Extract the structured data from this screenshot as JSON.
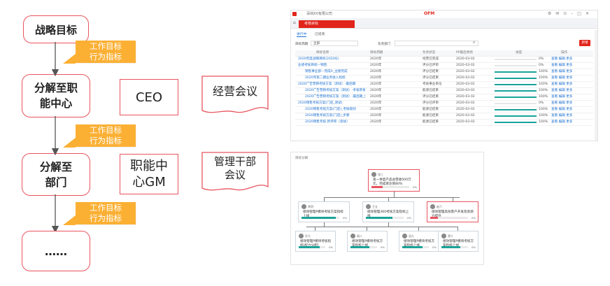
{
  "flow": {
    "step1": "战略目标",
    "step2_line1": "分解至职",
    "step2_line2": "能中心",
    "step3_line1": "分解至",
    "step3_line2": "部门",
    "step4": "……",
    "callout_line1": "工作目标",
    "callout_line2": "行为指标"
  },
  "side": {
    "ceo": "CEO",
    "meeting1": "经营会议",
    "gm_line1": "职能中",
    "gm_line2": "心GM",
    "meeting2_line1": "管理干部",
    "meeting2_line2": "会议"
  },
  "colors": {
    "flow_border": "#e8545e",
    "callout_fill": "#fbb034",
    "accent_red": "#e1251b",
    "progress_teal": "#1aa39a"
  },
  "screenshot1": {
    "company": "深圳XX有限公司",
    "brand": "OFM",
    "tab": "考核目标",
    "subtabs": [
      "进行中",
      "已结束"
    ],
    "filter_labels": [
      "目标周期",
      "全部",
      "负责部门"
    ],
    "new_button": "新增",
    "columns": [
      "目标名称",
      "目标周期",
      "负责状态",
      "PP最后更新",
      "进度",
      "操作"
    ],
    "rows": [
      {
        "name": "2020年度战略目标(2020Q)",
        "period": "2020年",
        "status": "经营已完成",
        "date": "2020-03-02",
        "pct": "0%",
        "p": 0
      },
      {
        "name": "业绩考核目标—销售",
        "period": "2020年",
        "status": "评分已评审",
        "date": "2020-03-02",
        "pct": "0%",
        "p": 0
      },
      {
        "name": "销售事业部—完成A_业绩完成",
        "period": "2020年",
        "status": "评分已结束",
        "date": "2020-03-02",
        "pct": "100%",
        "p": 1
      },
      {
        "name": "2020年第二期业务收入指标",
        "period": "2020年",
        "status": "评分已结束",
        "date": "2020-03-02",
        "pct": "100%",
        "p": 1
      },
      {
        "name": "2020广告营销考核方案（测试）-最后期",
        "period": "2020年",
        "status": "考核事业单位",
        "date": "2020-03-02",
        "pct": "100%",
        "p": 1
      },
      {
        "name": "2020广告营销考核方案（测试）-考核审批",
        "period": "2020年",
        "status": "能源已结束",
        "date": "2020-03-02",
        "pct": "100%",
        "p": 1
      },
      {
        "name": "2020广告营销考核方案（测试）-最后期_步骤",
        "period": "2020年",
        "status": "评分已结束",
        "date": "2020-03-02",
        "pct": "100%",
        "p": 1
      },
      {
        "name": "2020销售考核方案(门店_测试)",
        "period": "2020年",
        "status": "评分已评审",
        "date": "2020-03-02",
        "pct": "0%",
        "p": 0
      },
      {
        "name": "2020销售考核方案(门店)_考核级别",
        "period": "2020年",
        "status": "能源已结束",
        "date": "2020-03-02",
        "pct": "100%",
        "p": 1
      },
      {
        "name": "2020销售考核方案(门店)_步骤",
        "period": "2020年",
        "status": "能源已结束",
        "date": "2020-03-02",
        "pct": "100%",
        "p": 1
      },
      {
        "name": "2020销售考核 新评审（测试）",
        "period": "2020年",
        "status": "能源已结束",
        "date": "2020-03-02",
        "pct": "100%",
        "p": 1
      }
    ],
    "actions": [
      "查看",
      "编辑",
      "更多"
    ]
  },
  "screenshot2": {
    "title": "目标分解",
    "root": {
      "name": "张三",
      "text": "第一季度产品总营收500万元，完成率达到80%",
      "pct": "0%",
      "p": 0.3
    },
    "level2": [
      {
        "name": "李四",
        "text": "绩效管理P模块考核方案指标上线",
        "pct": "0%",
        "p": 0.9
      },
      {
        "name": "王五",
        "text": "绩效管理360考核方案指标上线",
        "pct": "0%",
        "p": 0.7
      },
      {
        "name": "赵六",
        "text": "绩效管理高效客户开发及资源力提升",
        "pct": "0%",
        "p": 0.2
      }
    ],
    "level3": [
      {
        "name": "孙七",
        "text": "绩效管理P模块考核指标(权力分配)",
        "pct": "0%",
        "p": 0.8
      },
      {
        "name": "周八",
        "text": "绩效管理P模块考核方案指标上线",
        "pct": "0%",
        "p": 0.7
      },
      {
        "name": "吴九",
        "text": "绩效管理P模块考核方案指标上线",
        "pct": "0%",
        "p": 0.75
      },
      {
        "name": "郑十",
        "text": "绩效管理P模块考核方案指标上线",
        "pct": "0%",
        "p": 0.7
      }
    ]
  }
}
